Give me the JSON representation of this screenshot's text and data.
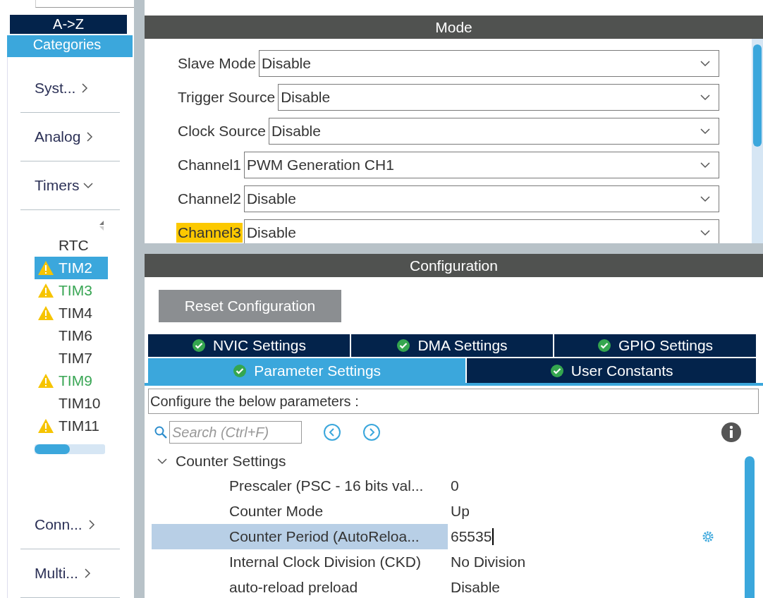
{
  "sidebar": {
    "sort_tabs": [
      {
        "label": "A->Z",
        "selected": false
      },
      {
        "label": "Categories",
        "selected": true
      }
    ],
    "categories": [
      {
        "label": "Syst...",
        "expanded": false
      },
      {
        "label": "Analog",
        "expanded": false
      },
      {
        "label": "Timers",
        "expanded": true,
        "children": [
          {
            "label": "RTC",
            "warning": false,
            "selected": false,
            "color": "#333333"
          },
          {
            "label": "TIM2",
            "warning": true,
            "selected": true,
            "color": "#ffffff"
          },
          {
            "label": "TIM3",
            "warning": true,
            "selected": false,
            "color": "#3aa655"
          },
          {
            "label": "TIM4",
            "warning": true,
            "selected": false,
            "color": "#333333"
          },
          {
            "label": "TIM6",
            "warning": false,
            "selected": false,
            "color": "#333333"
          },
          {
            "label": "TIM7",
            "warning": false,
            "selected": false,
            "color": "#333333"
          },
          {
            "label": "TIM9",
            "warning": true,
            "selected": false,
            "color": "#3aa655"
          },
          {
            "label": "TIM10",
            "warning": false,
            "selected": false,
            "color": "#333333"
          },
          {
            "label": "TIM11",
            "warning": true,
            "selected": false,
            "color": "#333333"
          }
        ]
      },
      {
        "label": "Conn...",
        "expanded": false
      },
      {
        "label": "Multi...",
        "expanded": false
      }
    ]
  },
  "mode": {
    "title": "Mode",
    "rows": [
      {
        "label": "Slave Mode",
        "value": "Disable",
        "highlighted": false
      },
      {
        "label": "Trigger Source",
        "value": "Disable",
        "highlighted": false
      },
      {
        "label": "Clock Source",
        "value": "Disable",
        "highlighted": false
      },
      {
        "label": "Channel1",
        "value": "PWM Generation CH1",
        "highlighted": false
      },
      {
        "label": "Channel2",
        "value": "Disable",
        "highlighted": false
      },
      {
        "label": "Channel3",
        "value": "Disable",
        "highlighted": true
      }
    ]
  },
  "configuration": {
    "title": "Configuration",
    "reset_button": "Reset Configuration",
    "tab_rows": [
      [
        {
          "label": "NVIC Settings",
          "selected": false
        },
        {
          "label": "DMA Settings",
          "selected": false
        },
        {
          "label": "GPIO Settings",
          "selected": false
        }
      ],
      [
        {
          "label": "Parameter Settings",
          "selected": true
        },
        {
          "label": "User Constants",
          "selected": false
        }
      ]
    ],
    "description": "Configure the below parameters :",
    "search": {
      "placeholder": "Search (Ctrl+F)"
    },
    "groups": [
      {
        "label": "Counter Settings",
        "expanded": true,
        "children": [
          {
            "name": "Prescaler (PSC - 16 bits val...",
            "value": "0",
            "selected": false
          },
          {
            "name": "Counter Mode",
            "value": "Up",
            "selected": false
          },
          {
            "name": "Counter Period (AutoReloa...",
            "value": "65535",
            "selected": true
          },
          {
            "name": "Internal Clock Division (CKD)",
            "value": "No Division",
            "selected": false
          },
          {
            "name": "auto-reload preload",
            "value": "Disable",
            "selected": false
          }
        ]
      }
    ]
  }
}
